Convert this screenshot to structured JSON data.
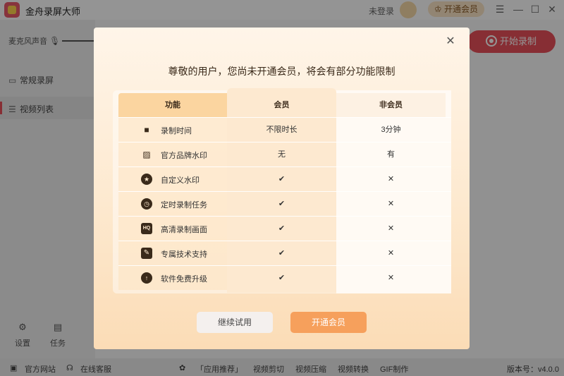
{
  "app": {
    "title": "金舟录屏大师",
    "login_label": "未登录",
    "vip_button": "开通会员",
    "window_controls": {
      "menu": "☰",
      "minimize": "—",
      "maximize": "☐",
      "close": "✕"
    }
  },
  "sidebar": {
    "mic_label": "麦克风声音",
    "items": [
      {
        "label": "常规录屏",
        "icon": "record-screen-icon"
      },
      {
        "label": "视频列表",
        "icon": "list-icon"
      }
    ],
    "bottom_tools": [
      {
        "label": "设置",
        "icon": "gear-icon"
      },
      {
        "label": "任务",
        "icon": "task-icon"
      }
    ]
  },
  "main": {
    "record_button": "开始录制"
  },
  "statusbar": {
    "links": [
      "官方网站",
      "在线客服"
    ],
    "apps": [
      "「应用推荐」",
      "视频剪切",
      "视频压缩",
      "视频转换",
      "GIF制作"
    ],
    "version": "版本号：v4.0.0"
  },
  "dialog": {
    "title": "尊敬的用户，您尚未开通会员，将会有部分功能限制",
    "headers": {
      "feature": "功能",
      "vip": "会员",
      "non_vip": "非会员"
    },
    "rows": [
      {
        "feature": "录制时间",
        "icon": "video-camera-icon",
        "vip": "不限时长",
        "non_vip": "3分钟",
        "vip_type": "text",
        "non_type": "text"
      },
      {
        "feature": "官方品牌水印",
        "icon": "watermark-stripes-icon",
        "vip": "无",
        "non_vip": "有",
        "vip_type": "text",
        "non_type": "text"
      },
      {
        "feature": "自定义水印",
        "icon": "star-badge-icon",
        "vip": "✔",
        "non_vip": "✕",
        "vip_type": "check",
        "non_type": "cross"
      },
      {
        "feature": "定时录制任务",
        "icon": "timer-icon",
        "vip": "✔",
        "non_vip": "✕",
        "vip_type": "check",
        "non_type": "cross"
      },
      {
        "feature": "高清录制画面",
        "icon": "hq-icon",
        "vip": "✔",
        "non_vip": "✕",
        "vip_type": "check",
        "non_type": "cross"
      },
      {
        "feature": "专属技术支持",
        "icon": "wrench-icon",
        "vip": "✔",
        "non_vip": "✕",
        "vip_type": "check",
        "non_type": "cross"
      },
      {
        "feature": "软件免费升级",
        "icon": "upgrade-arrow-icon",
        "vip": "✔",
        "non_vip": "✕",
        "vip_type": "check",
        "non_type": "cross"
      }
    ],
    "buttons": {
      "trial": "继续试用",
      "open_vip": "开通会员"
    },
    "colors": {
      "accent": "#f6a05c",
      "check": "#2fb53c",
      "cross": "#e24b3b"
    }
  }
}
